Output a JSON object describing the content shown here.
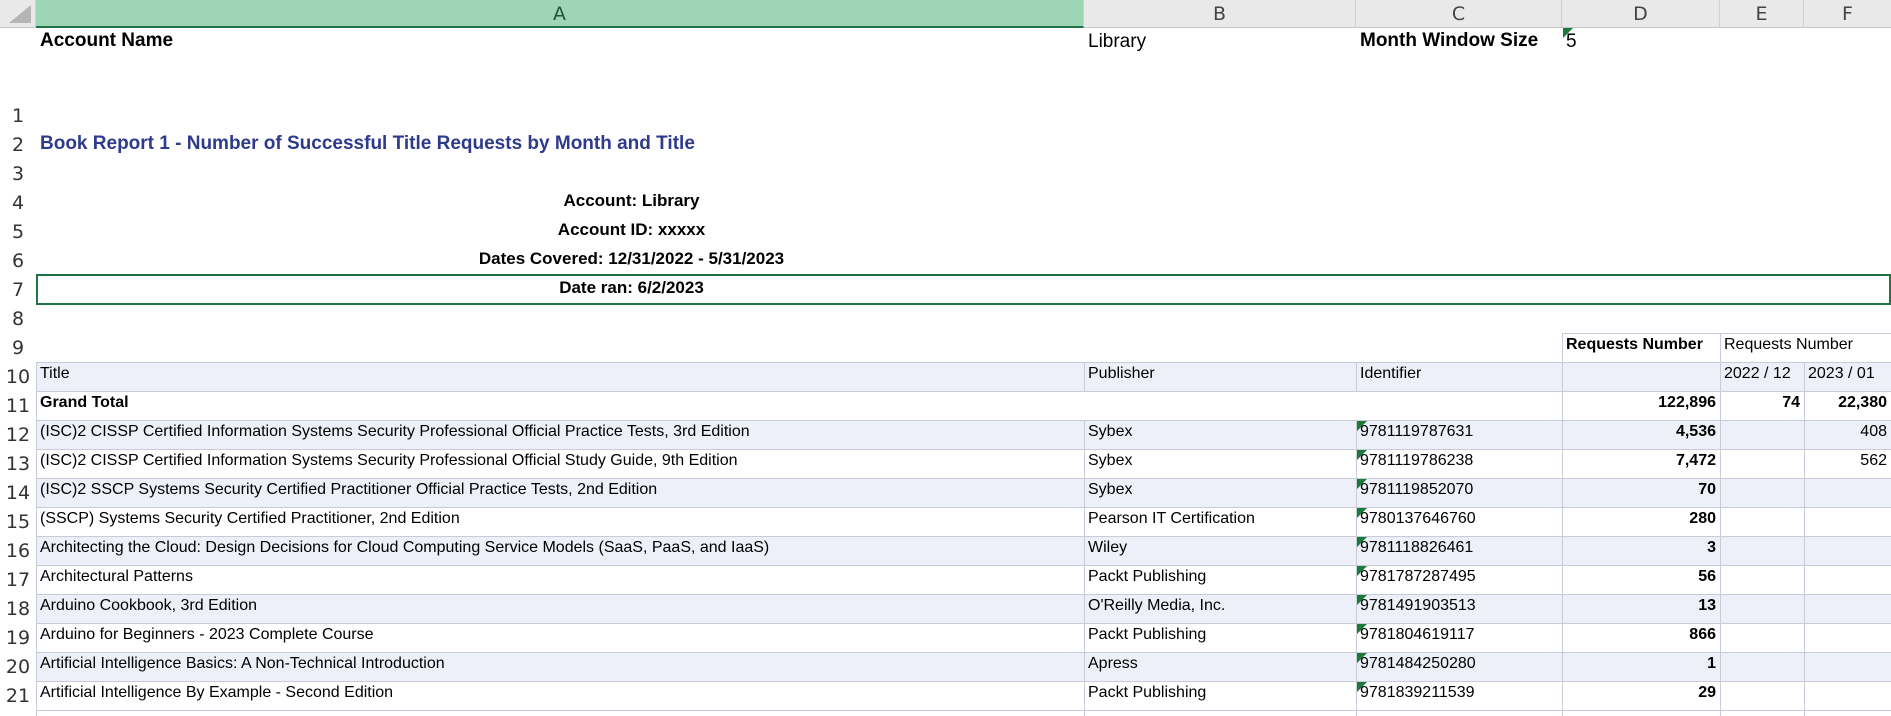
{
  "columns": [
    {
      "letter": "A"
    },
    {
      "letter": "B"
    },
    {
      "letter": "C"
    },
    {
      "letter": "D"
    },
    {
      "letter": "E"
    },
    {
      "letter": "F"
    }
  ],
  "top_row": {
    "account_name_label": "Account Name",
    "account_name_value": "Library",
    "month_window_label": "Month Window Size",
    "month_window_value": "5"
  },
  "row_numbers": [
    "1",
    "2",
    "3",
    "4",
    "5",
    "6",
    "7",
    "8",
    "9",
    "10",
    "11",
    "12",
    "13",
    "14",
    "15",
    "16",
    "17",
    "18",
    "19",
    "20",
    "21"
  ],
  "report": {
    "title": "Book Report 1 - Number of Successful Title Requests by Month and Title",
    "account_line": "Account: Library",
    "account_id_line": "Account ID: xxxxx",
    "dates_covered_line": "Dates Covered: 12/31/2022 - 5/31/2023",
    "date_ran_line": "Date ran: 6/2/2023"
  },
  "table": {
    "headers": {
      "requests_number_bold": "Requests Number",
      "requests_number": "Requests Number",
      "title": "Title",
      "publisher": "Publisher",
      "identifier": "Identifier",
      "month_1": "2022 / 12",
      "month_2": "2023 / 01"
    },
    "grand_total": {
      "label": "Grand Total",
      "total": "122,896",
      "m1": "74",
      "m2": "22,380"
    },
    "rows": [
      {
        "title": "(ISC)2 CISSP Certified Information Systems Security Professional Official Practice Tests, 3rd Edition",
        "publisher": "Sybex",
        "identifier": "9781119787631",
        "total": "4,536",
        "m1": "",
        "m2": "408"
      },
      {
        "title": "(ISC)2 CISSP Certified Information Systems Security Professional Official Study Guide, 9th Edition",
        "publisher": "Sybex",
        "identifier": "9781119786238",
        "total": "7,472",
        "m1": "",
        "m2": "562"
      },
      {
        "title": "(ISC)2 SSCP Systems Security Certified Practitioner Official Practice Tests, 2nd Edition",
        "publisher": "Sybex",
        "identifier": "9781119852070",
        "total": "70",
        "m1": "",
        "m2": ""
      },
      {
        "title": "(SSCP) Systems Security Certified Practitioner, 2nd Edition",
        "publisher": "Pearson IT Certification",
        "identifier": "9780137646760",
        "total": "280",
        "m1": "",
        "m2": ""
      },
      {
        "title": "Architecting the Cloud: Design Decisions for Cloud Computing Service Models (SaaS, PaaS, and IaaS)",
        "publisher": "Wiley",
        "identifier": "9781118826461",
        "total": "3",
        "m1": "",
        "m2": ""
      },
      {
        "title": "Architectural Patterns",
        "publisher": "Packt Publishing",
        "identifier": "9781787287495",
        "total": "56",
        "m1": "",
        "m2": ""
      },
      {
        "title": "Arduino Cookbook, 3rd Edition",
        "publisher": "O'Reilly Media, Inc.",
        "identifier": "9781491903513",
        "total": "13",
        "m1": "",
        "m2": ""
      },
      {
        "title": "Arduino for Beginners - 2023 Complete Course",
        "publisher": "Packt Publishing",
        "identifier": "9781804619117",
        "total": "866",
        "m1": "",
        "m2": ""
      },
      {
        "title": "Artificial Intelligence Basics: A Non-Technical Introduction",
        "publisher": "Apress",
        "identifier": "9781484250280",
        "total": "1",
        "m1": "",
        "m2": ""
      },
      {
        "title": "Artificial Intelligence By Example - Second Edition",
        "publisher": "Packt Publishing",
        "identifier": "9781839211539",
        "total": "29",
        "m1": "",
        "m2": ""
      }
    ]
  }
}
